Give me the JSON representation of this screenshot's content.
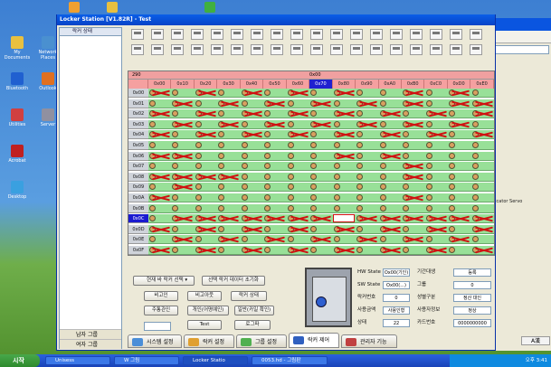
{
  "desktop": {
    "icons": [
      {
        "label": "My Documents",
        "color": "#e8c040"
      },
      {
        "label": "Network Places",
        "color": "#4a90d0"
      },
      {
        "label": "Bluetooth",
        "color": "#2060d0"
      },
      {
        "label": "Outlook",
        "color": "#e07020"
      },
      {
        "label": "Utilities",
        "color": "#d04040"
      },
      {
        "label": "Server",
        "color": "#9090a0"
      },
      {
        "label": "Acrobat",
        "color": "#c02020"
      },
      {
        "label": "Desktop",
        "color": "#3aa0e0"
      }
    ],
    "top_icons": [
      {
        "color": "#f0a030"
      },
      {
        "color": "#e8c040"
      },
      {
        "color": "#40b040"
      }
    ]
  },
  "bg_window": {
    "text": "nicator Servo",
    "ime": "A漢"
  },
  "window": {
    "title": "Locker Station [V1.82R] - Test",
    "left_header": "락커 상태",
    "groups": [
      "남자 그룹",
      "여자 그룹"
    ]
  },
  "grid": {
    "top_label": "0x00",
    "corner": "290",
    "columns": [
      "0x00",
      "0x10",
      "0x20",
      "0x30",
      "0x40",
      "0x50",
      "0x60",
      "0x70",
      "0x80",
      "0x90",
      "0xA0",
      "0xB0",
      "0xC0",
      "0xD0",
      "0xE0"
    ],
    "rows": [
      "0x00",
      "0x01",
      "0x02",
      "0x03",
      "0x04",
      "0x05",
      "0x06",
      "0x07",
      "0x08",
      "0x09",
      "0x0A",
      "0x0B",
      "0x0C",
      "0x0D",
      "0x0E",
      "0x0F"
    ],
    "selected_row": "0x0C"
  },
  "controls": {
    "group_select": "현재 바 락커 선택 ▾",
    "init_button": "선택 락커 데이터 초기화",
    "btn_open": "비고인",
    "btn_close": "비고아웃",
    "btn_status": "락커 상태",
    "btn_owner": "주통관인",
    "btn_extend": "개인(어명예인)",
    "btn_check": "일반(카일 확인)",
    "btn_test": "Test",
    "btn_log": "로그파",
    "counter": ""
  },
  "info": {
    "labels": [
      "HW State",
      "SW State",
      "락커번호",
      "사용금액",
      "상태",
      "기간대생",
      "그룹",
      "성별구분",
      "사용자정보",
      "카드번호"
    ],
    "values": [
      "Ox00(기인)",
      "Ox00(...)",
      "0",
      "사용인형",
      "22",
      "등록",
      "0",
      "정산 대인",
      "정상",
      "0000000000"
    ]
  },
  "tabs": [
    "시스템 설정",
    "락커 설정",
    "그룹 설정",
    "락커 제어",
    "관리자 기능"
  ],
  "taskbar": {
    "start": "시작",
    "items": [
      "Unisess",
      "W 그림",
      "Locker Statio",
      "0053.hd - 그림판"
    ],
    "tray": "오후 3:41"
  }
}
